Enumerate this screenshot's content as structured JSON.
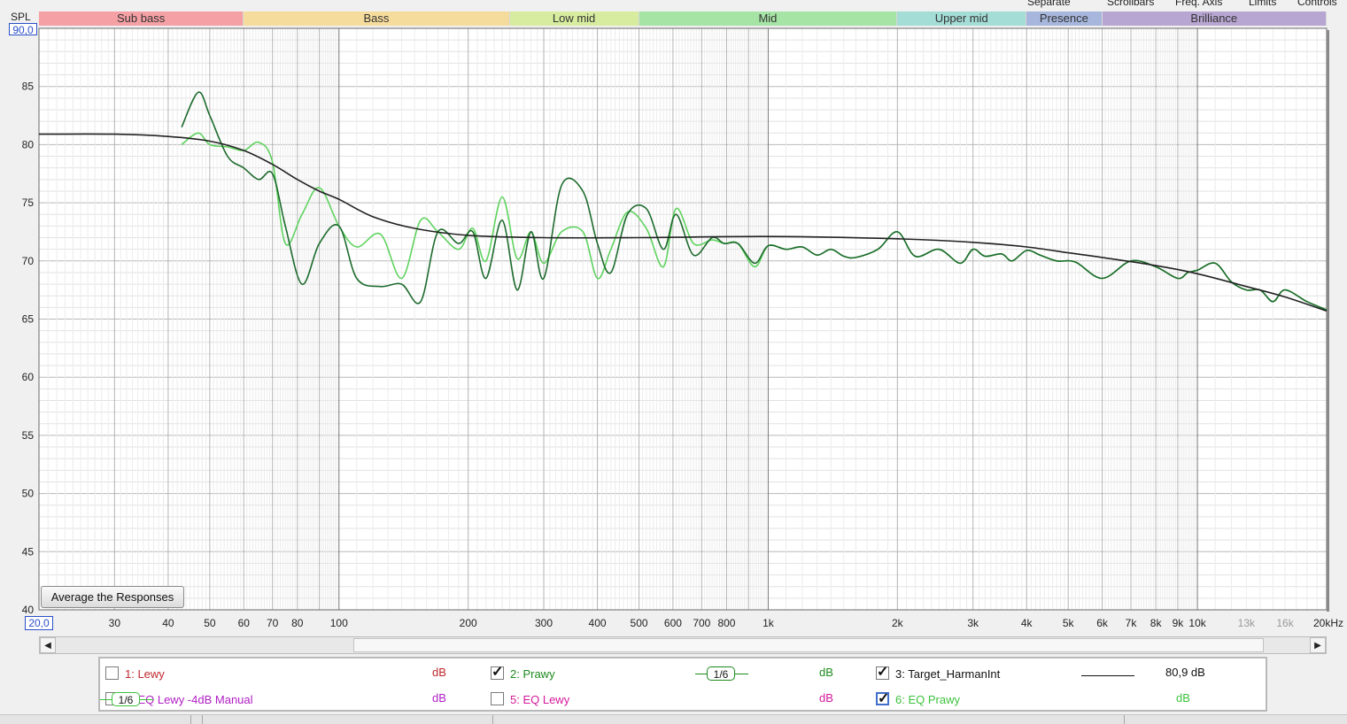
{
  "top_controls": [
    "Separate",
    "Scrollbars",
    "Freq. Axis",
    "Limits",
    "Controls"
  ],
  "y_axis_label": "SPL",
  "y_max_value": "90,0",
  "x_min_value": "20,0",
  "y_ticks": [
    "85",
    "80",
    "75",
    "70",
    "65",
    "60",
    "55",
    "50",
    "45",
    "40"
  ],
  "x_ticks": [
    {
      "f": 30,
      "label": "30"
    },
    {
      "f": 40,
      "label": "40"
    },
    {
      "f": 50,
      "label": "50"
    },
    {
      "f": 60,
      "label": "60"
    },
    {
      "f": 70,
      "label": "70"
    },
    {
      "f": 80,
      "label": "80"
    },
    {
      "f": 100,
      "label": "100"
    },
    {
      "f": 200,
      "label": "200"
    },
    {
      "f": 300,
      "label": "300"
    },
    {
      "f": 400,
      "label": "400"
    },
    {
      "f": 500,
      "label": "500"
    },
    {
      "f": 600,
      "label": "600"
    },
    {
      "f": 700,
      "label": "700"
    },
    {
      "f": 800,
      "label": "800"
    },
    {
      "f": 1000,
      "label": "1k"
    },
    {
      "f": 2000,
      "label": "2k"
    },
    {
      "f": 3000,
      "label": "3k"
    },
    {
      "f": 4000,
      "label": "4k"
    },
    {
      "f": 5000,
      "label": "5k"
    },
    {
      "f": 6000,
      "label": "6k"
    },
    {
      "f": 7000,
      "label": "7k"
    },
    {
      "f": 8000,
      "label": "8k"
    },
    {
      "f": 9000,
      "label": "9k"
    },
    {
      "f": 10000,
      "label": "10k"
    },
    {
      "f": 13000,
      "label": "13k",
      "faint": true
    },
    {
      "f": 16000,
      "label": "16k",
      "faint": true
    },
    {
      "f": 20000,
      "label": "20kHz"
    }
  ],
  "bands": [
    {
      "name": "Sub bass",
      "from": 20,
      "to": 60,
      "color": "#f4a0a4"
    },
    {
      "name": "Bass",
      "from": 60,
      "to": 250,
      "color": "#f6dc9c"
    },
    {
      "name": "Low mid",
      "from": 250,
      "to": 500,
      "color": "#d7ec9e"
    },
    {
      "name": "Mid",
      "from": 500,
      "to": 2000,
      "color": "#a6e4a6"
    },
    {
      "name": "Upper mid",
      "from": 2000,
      "to": 4000,
      "color": "#a4dcd6"
    },
    {
      "name": "Presence",
      "from": 4000,
      "to": 6000,
      "color": "#a6b6dc"
    },
    {
      "name": "Brilliance",
      "from": 6000,
      "to": 20000,
      "color": "#b8a6d2"
    }
  ],
  "avg_button_label": "Average the Responses",
  "scroll": {
    "left_arrow": "◀",
    "right_arrow": "▶"
  },
  "legend": [
    {
      "label": "1: Lewy",
      "checked": false,
      "color": "#c0272d",
      "unit": "dB",
      "value": ""
    },
    {
      "label": "2: Prawy",
      "checked": true,
      "color": "#1d8a1d",
      "smoothing": "1/6",
      "unit": "dB",
      "value": ""
    },
    {
      "label": "3: Target_HarmanInt",
      "checked": true,
      "color": "#111111",
      "unit": "",
      "value": "80,9 dB"
    },
    {
      "label": "4: EQ Lewy -4dB Manual",
      "checked": false,
      "color": "#b01ec4",
      "unit": "dB",
      "value": ""
    },
    {
      "label": "5: EQ Lewy",
      "checked": false,
      "color": "#d4189a",
      "unit": "dB",
      "value": ""
    },
    {
      "label": "6: EQ Prawy",
      "checked": true,
      "color": "#3cc23c",
      "smoothing": "1/6",
      "unit": "dB",
      "value": ""
    }
  ],
  "chart_data": {
    "type": "line",
    "xlabel": "",
    "ylabel": "SPL",
    "x_scale": "log",
    "xlim": [
      20,
      20000
    ],
    "ylim": [
      40,
      90
    ],
    "grid": true,
    "series": [
      {
        "name": "2: Prawy",
        "color": "#1d6b2d",
        "x": [
          43,
          47,
          50,
          55,
          60,
          65,
          70,
          75,
          82,
          90,
          100,
          110,
          125,
          140,
          155,
          170,
          190,
          205,
          220,
          240,
          260,
          280,
          300,
          330,
          370,
          400,
          430,
          470,
          520,
          570,
          610,
          670,
          740,
          790,
          850,
          930,
          1000,
          1100,
          1200,
          1300,
          1400,
          1500,
          1600,
          1800,
          2000,
          2200,
          2500,
          2800,
          3000,
          3200,
          3500,
          3700,
          4000,
          4300,
          4700,
          5200,
          6000,
          7000,
          8000,
          9000,
          9500,
          10000,
          11000,
          12000,
          13000,
          14000,
          15000,
          16000,
          18000,
          20000
        ],
        "y": [
          81.5,
          84.5,
          82.5,
          79,
          78,
          77,
          77.5,
          73,
          68,
          71.5,
          73,
          68.5,
          67.8,
          68,
          66.5,
          72.5,
          71.5,
          72.5,
          68.5,
          73.5,
          67.5,
          72.5,
          68.5,
          76.5,
          76,
          71.5,
          69,
          74,
          74.5,
          71,
          74,
          70.5,
          72,
          71.5,
          71.5,
          69.8,
          71.3,
          71,
          71.2,
          70.5,
          71,
          70.4,
          70.3,
          71,
          72.5,
          70.4,
          71,
          69.8,
          71,
          70.4,
          70.6,
          70,
          70.9,
          70.5,
          70,
          69.9,
          68.5,
          70,
          69.5,
          68.5,
          69,
          69.2,
          69.8,
          68.2,
          67.5,
          67.5,
          66.5,
          67.5,
          66.5,
          65.8
        ]
      },
      {
        "name": "6: EQ Prawy",
        "color": "#5fd35f",
        "x": [
          43,
          47,
          50,
          55,
          60,
          65,
          70,
          75,
          82,
          90,
          100,
          110,
          125,
          140,
          155,
          170,
          190,
          205,
          220,
          240,
          260,
          280,
          300,
          330,
          370,
          400,
          430,
          470,
          520,
          570,
          610,
          670,
          740,
          790,
          850,
          930,
          1000,
          1100,
          1200,
          1300,
          1400,
          1500,
          1600,
          1800,
          2000,
          2200,
          2500,
          2800,
          3000,
          3200,
          3500,
          3700,
          4000,
          4300,
          4700,
          5200,
          6000,
          7000,
          8000,
          9000,
          9500,
          10000,
          11000,
          12000,
          13000,
          14000,
          15000,
          16000,
          18000,
          20000
        ],
        "y": [
          80,
          81,
          80,
          79.8,
          79.5,
          80.2,
          78.5,
          71.5,
          74,
          76.3,
          73,
          71.2,
          72.3,
          68.5,
          73.5,
          72.5,
          71,
          72.8,
          70,
          75.5,
          70.2,
          72.5,
          69.8,
          72.5,
          72.5,
          68.5,
          71,
          74.2,
          72.8,
          69.5,
          74.5,
          71.5,
          71.8,
          71.5,
          71.5,
          69.5,
          71.3,
          71,
          71.2,
          70.5,
          71,
          70.4,
          70.3,
          71,
          72.5,
          70.4,
          71,
          69.8,
          71,
          70.4,
          70.6,
          70,
          70.9,
          70.5,
          70,
          69.9,
          68.5,
          70,
          69.5,
          68.5,
          69,
          69.2,
          69.8,
          68.2,
          67.5,
          67.5,
          66.5,
          67.5,
          66.5,
          65.8
        ]
      },
      {
        "name": "3: Target_HarmanInt",
        "color": "#222222",
        "x": [
          20,
          30,
          40,
          50,
          60,
          70,
          80,
          90,
          100,
          120,
          150,
          200,
          300,
          500,
          1000,
          2000,
          3000,
          4000,
          5000,
          6000,
          8000,
          10000,
          13000,
          16000,
          20000
        ],
        "y": [
          80.9,
          80.9,
          80.7,
          80.3,
          79.5,
          78.3,
          77,
          76,
          75.3,
          73.8,
          72.8,
          72.2,
          72,
          72,
          72.1,
          71.9,
          71.6,
          71.2,
          70.7,
          70.3,
          69.6,
          68.9,
          67.8,
          66.9,
          65.7
        ]
      }
    ]
  }
}
